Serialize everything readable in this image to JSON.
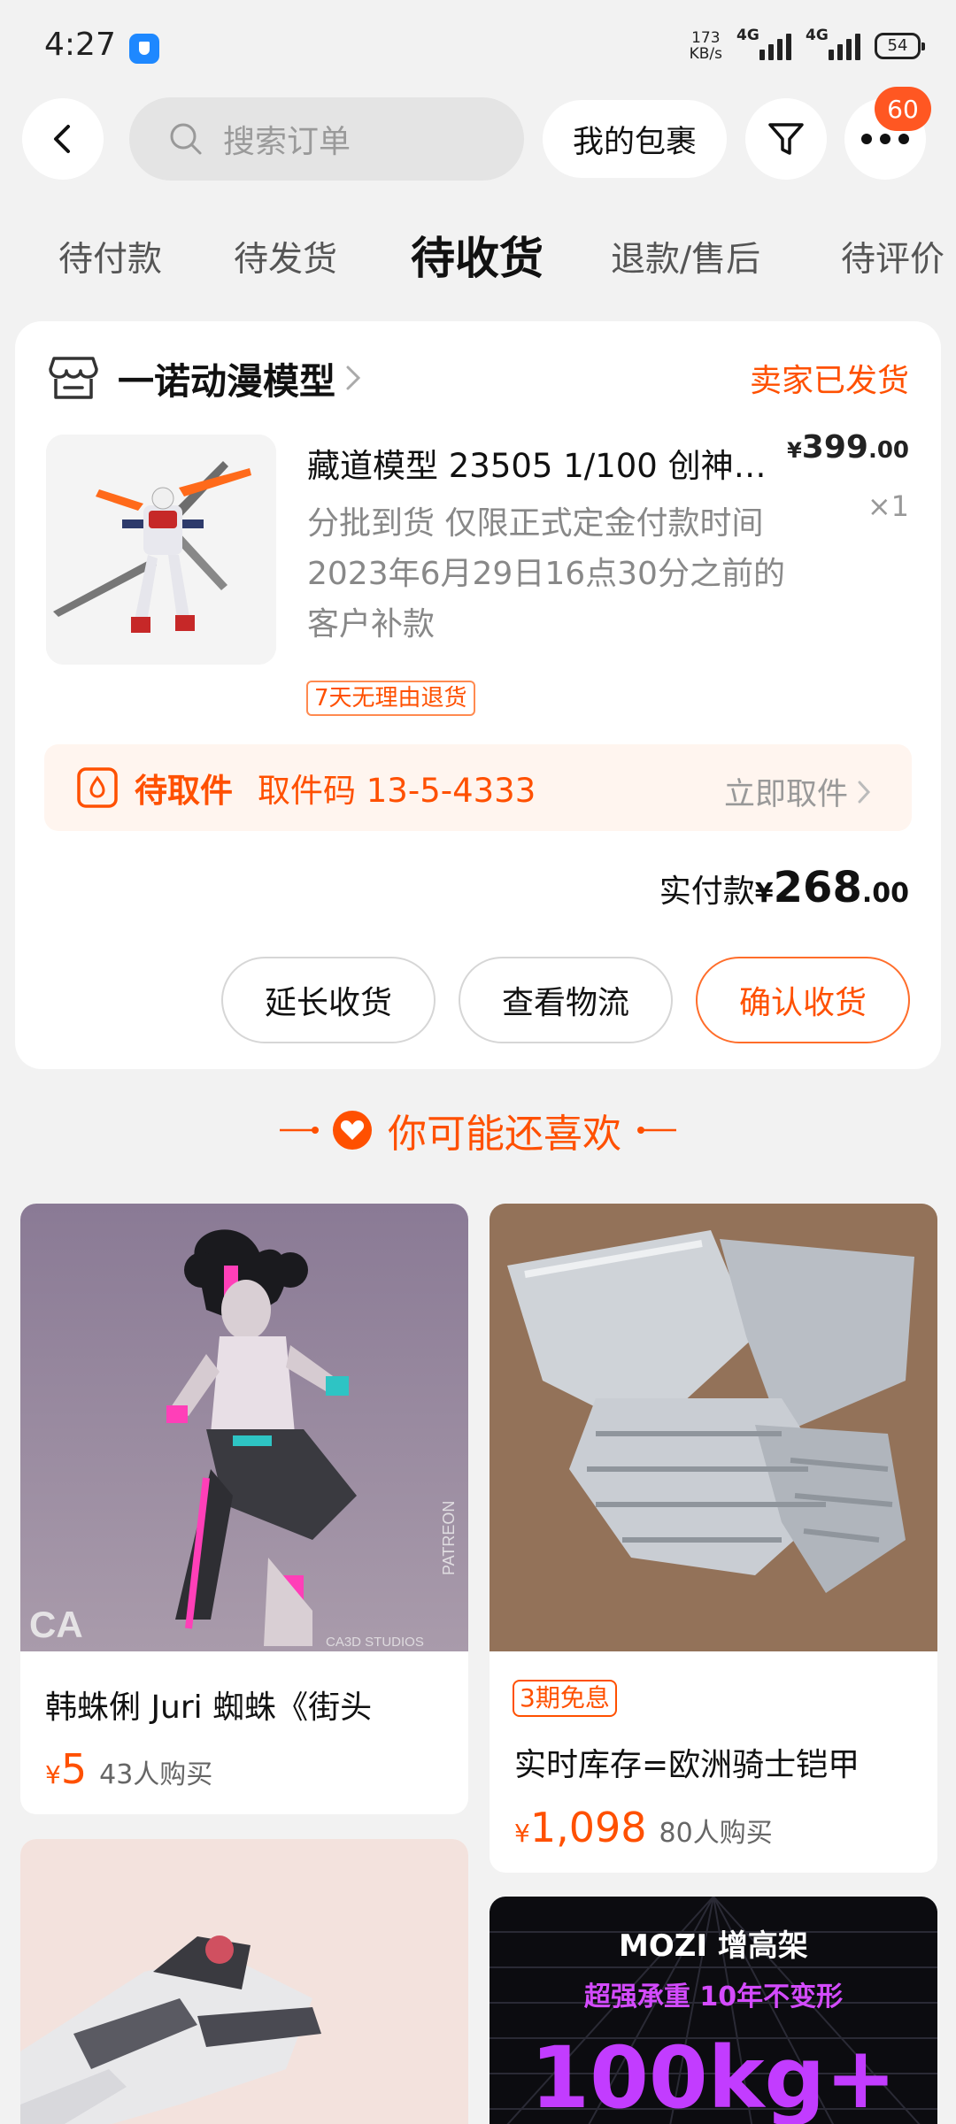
{
  "status_bar": {
    "time": "4:27",
    "net_speed_value": "173",
    "net_speed_unit": "KB/s",
    "signal1_label": "4G",
    "signal2_label": "4G",
    "battery": "54"
  },
  "header": {
    "search_placeholder": "搜索订单",
    "packages_label": "我的包裹",
    "more_badge": "60"
  },
  "tabs": [
    {
      "label": "待付款"
    },
    {
      "label": "待发货"
    },
    {
      "label": "待收货",
      "active": true
    },
    {
      "label": "退款/售后"
    },
    {
      "label": "待评价"
    }
  ],
  "order": {
    "shop_name": "一诺动漫模型",
    "status": "卖家已发货",
    "title": "藏道模型 23505 1/100 创神…",
    "price_cur": "¥",
    "price_int": "399",
    "price_dec": ".00",
    "quantity": "×1",
    "description": "分批到货 仅限正式定金付款时间2023年6月29日16点30分之前的客户补款",
    "return_tag": "7天无理由退货",
    "pickup_status": "待取件",
    "pickup_code": "取件码 13-5-4333",
    "pickup_link": "立即取件",
    "paid_label": "实付款",
    "paid_cur": "¥",
    "paid_int": "268",
    "paid_dec": ".00",
    "actions": {
      "extend": "延长收货",
      "logistics": "查看物流",
      "confirm": "确认收货"
    }
  },
  "recommend": {
    "title": "你可能还喜欢",
    "items": [
      {
        "title": "韩蛛俐 Juri 蜘蛛《街头",
        "currency": "¥",
        "price": "5",
        "sold": "43人购买",
        "watermark_left": "CA",
        "watermark_side": "PATREON",
        "watermark_bottom": "CA3D STUDIOS"
      },
      {
        "tag": "3期免息",
        "title": "实时库存=欧洲骑士铠甲",
        "currency": "¥",
        "price": "1,098",
        "sold": "80人购买"
      },
      {
        "title": ""
      },
      {
        "ad_line1": "MOZI 增高架",
        "ad_line2": "超强承重 10年不变形",
        "ad_line3": "100kg+"
      }
    ]
  },
  "colors": {
    "accent": "#ff5000",
    "badge": "#ff5722",
    "background": "#f2f2f2"
  }
}
